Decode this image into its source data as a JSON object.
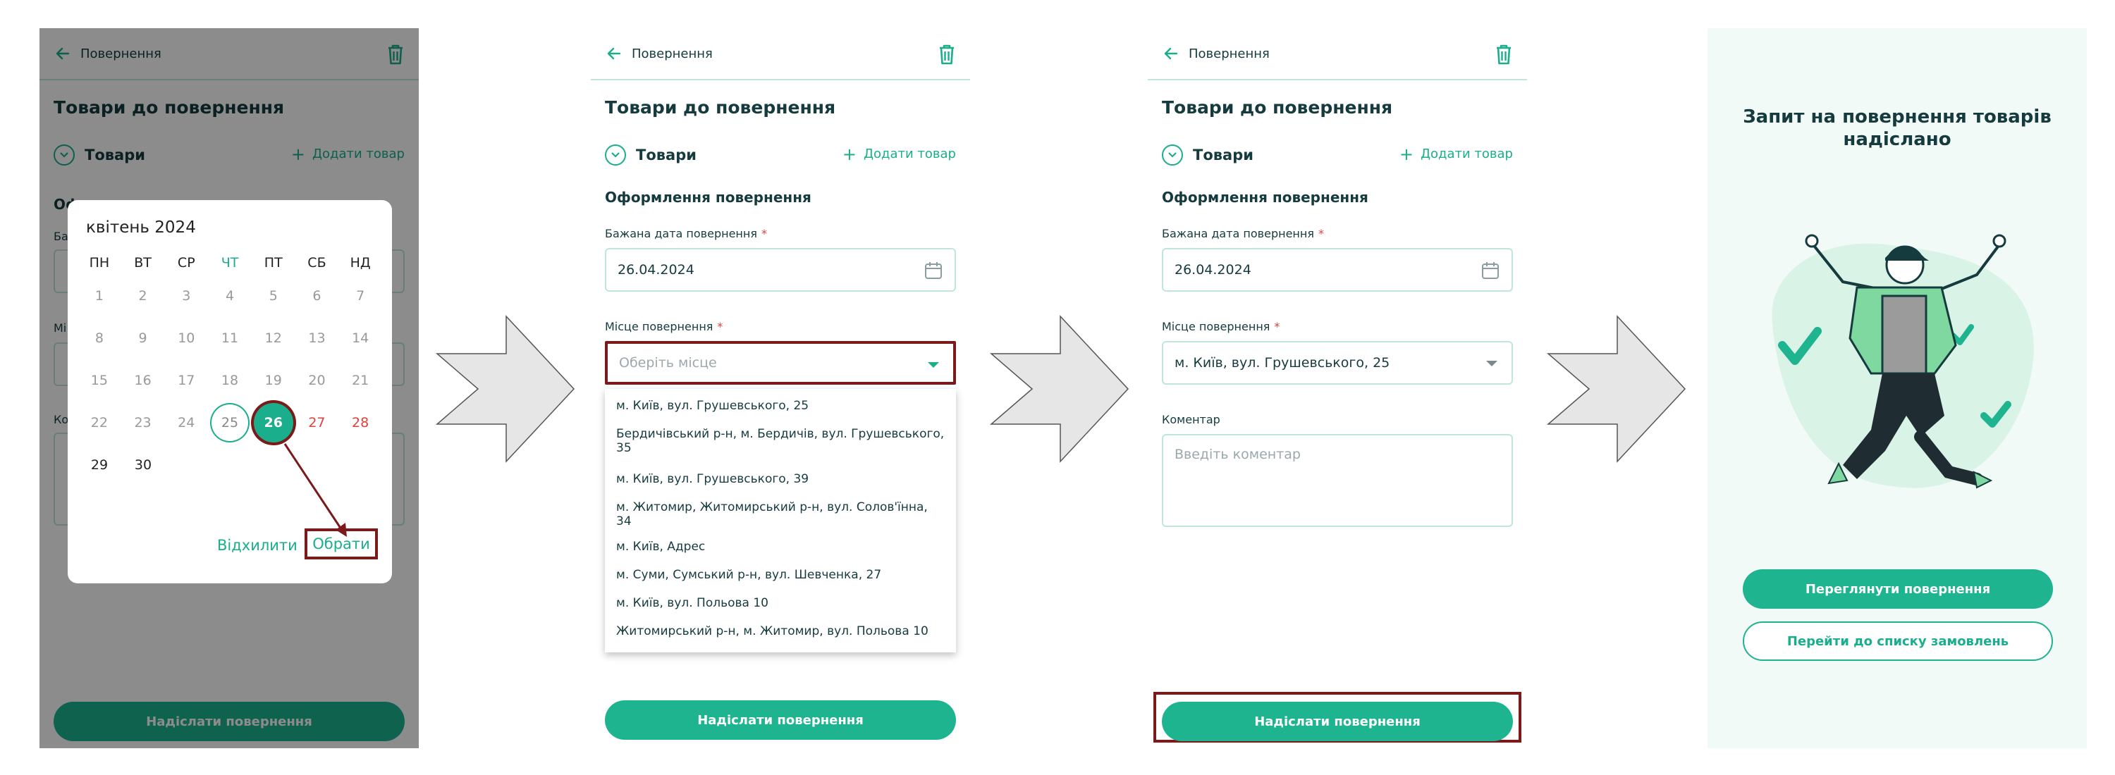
{
  "common": {
    "header_title": "Повернення",
    "page_title": "Товари до повернення",
    "goods_label": "Товари",
    "add_goods": "Додати товар",
    "section_title": "Оформлення повернення",
    "date_label": "Бажана дата повернення",
    "place_label": "Місце повернення",
    "required_mark": "*",
    "comment_label": "Коментар",
    "comment_placeholder": "Введіть коментар",
    "send_button": "Надіслати повернення"
  },
  "screen1": {
    "calendar": {
      "month": "квітень 2024",
      "weekdays": [
        "ПН",
        "ВТ",
        "СР",
        "ЧТ",
        "ПТ",
        "СБ",
        "НД"
      ],
      "rows": [
        [
          "1",
          "2",
          "3",
          "4",
          "5",
          "6",
          "7"
        ],
        [
          "8",
          "9",
          "10",
          "11",
          "12",
          "13",
          "14"
        ],
        [
          "15",
          "16",
          "17",
          "18",
          "19",
          "20",
          "21"
        ],
        [
          "22",
          "23",
          "24",
          "25",
          "26",
          "27",
          "28"
        ],
        [
          "29",
          "30"
        ]
      ],
      "today": "25",
      "selected": "26",
      "cancel": "Відхилити",
      "ok": "Обрати"
    },
    "bg_fragments": {
      "sec": "Оф",
      "date": "Ба",
      "place": "Мі",
      "comment": "Ко"
    }
  },
  "screen2": {
    "date_value": "26.04.2024",
    "place_placeholder": "Оберіть місце",
    "options": [
      "м. Київ, вул. Грушевського, 25",
      "Бердичівський р-н, м. Бердичів, вул. Грушевського, 35",
      "м. Київ, вул. Грушевського, 39",
      "м. Житомир, Житомирський р-н, вул. Солов'їнна, 34",
      "м. Київ, Адрес",
      "м. Суми, Сумський р-н, вул. Шевченка, 27",
      "м. Київ, вул. Польова 10",
      "Житомирський р-н, м. Житомир, вул. Польова 10"
    ]
  },
  "screen3": {
    "date_value": "26.04.2024",
    "place_value": "м. Київ, вул. Грушевського, 25"
  },
  "screen4": {
    "title": "Запит на повернення товарів надіслано",
    "view_button": "Переглянути повернення",
    "orders_button": "Перейти до списку замовлень"
  },
  "colors": {
    "accent": "#1db48f",
    "highlight": "#7b1a1a",
    "weekend": "#e2403a",
    "arrow_fill": "#e6e6e6"
  }
}
